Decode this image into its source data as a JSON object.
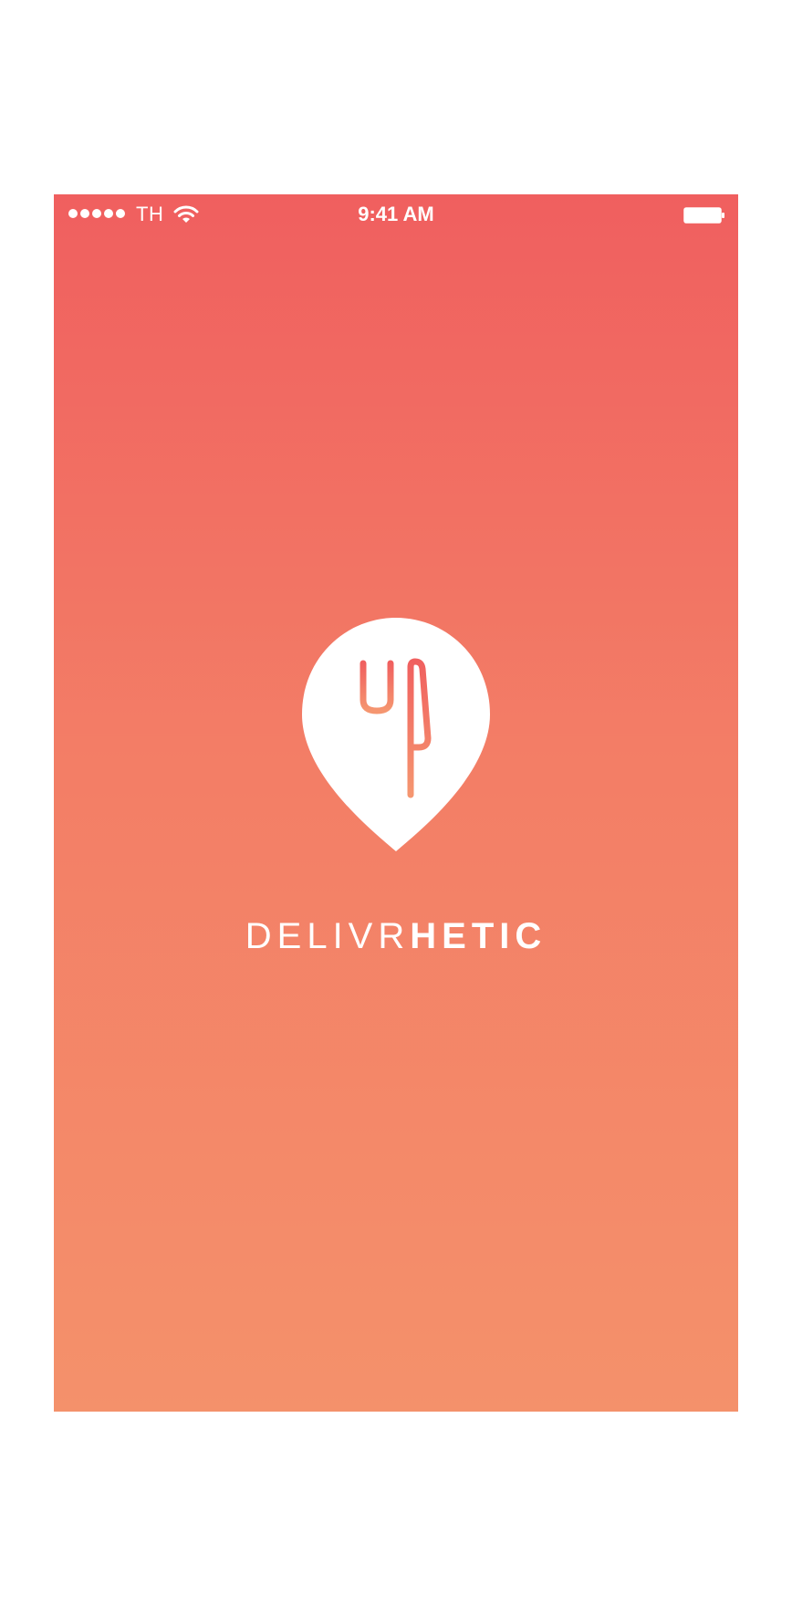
{
  "status_bar": {
    "carrier": "TH",
    "time": "9:41 AM",
    "icons": [
      "signal-dots-icon",
      "wifi-icon",
      "battery-icon"
    ]
  },
  "splash": {
    "logo_icon": "fork-knife-location-pin-icon",
    "brand_light": "DELIVR",
    "brand_bold": "HETIC"
  },
  "colors": {
    "gradient_top": "#f05f5f",
    "gradient_bottom": "#f4916b",
    "foreground": "#ffffff"
  }
}
